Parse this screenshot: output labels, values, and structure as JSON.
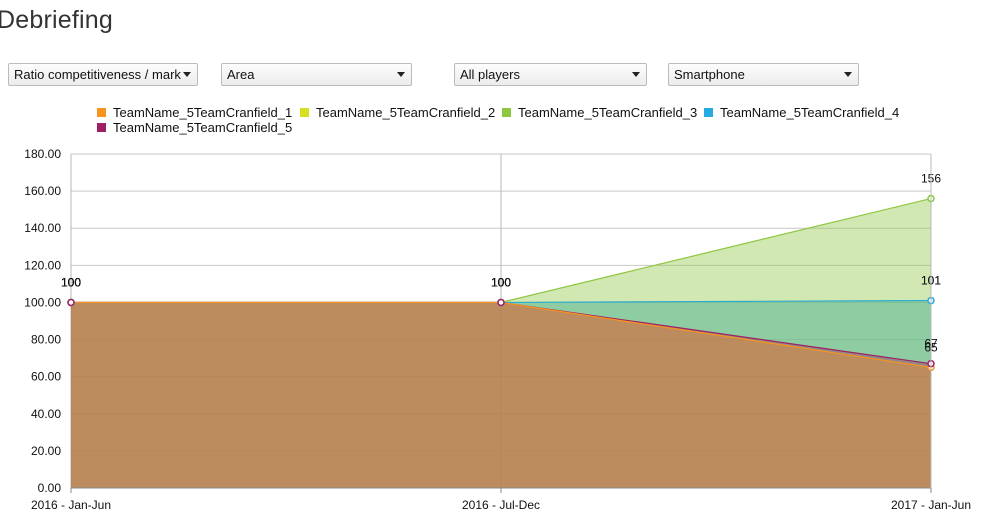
{
  "page": {
    "title": "Debriefing"
  },
  "controls": {
    "metric": {
      "value": "Ratio competitiveness / mark"
    },
    "chart_type": {
      "value": "Area"
    },
    "players": {
      "value": "All players"
    },
    "device": {
      "value": "Smartphone"
    }
  },
  "chart_data": {
    "type": "area",
    "categories": [
      "2016 - Jan-Jun",
      "2016 - Jul-Dec",
      "2017 - Jan-Jun"
    ],
    "ylim": [
      0,
      180
    ],
    "yticks": [
      0,
      20,
      40,
      60,
      80,
      100,
      120,
      140,
      160,
      180
    ],
    "ytick_labels": [
      "0.00",
      "20.00",
      "40.00",
      "60.00",
      "80.00",
      "100.00",
      "120.00",
      "140.00",
      "160.00",
      "180.00"
    ],
    "grid": true,
    "legend_position": "top",
    "series": [
      {
        "name": "TeamName_5TeamCranfield_1",
        "color": "#f7941d",
        "values": [
          100,
          100,
          65
        ],
        "labels": [
          "100",
          "100",
          "65"
        ]
      },
      {
        "name": "TeamName_5TeamCranfield_2",
        "color": "#d7df23",
        "values": [
          100,
          100,
          101
        ],
        "labels": [
          "100",
          "100",
          "101"
        ]
      },
      {
        "name": "TeamName_5TeamCranfield_3",
        "color": "#8dc63f",
        "values": [
          100,
          100,
          156
        ],
        "labels": [
          "100",
          "100",
          "156"
        ]
      },
      {
        "name": "TeamName_5TeamCranfield_4",
        "color": "#27aae1",
        "values": [
          100,
          100,
          101
        ],
        "labels": [
          "100",
          "100",
          "101"
        ]
      },
      {
        "name": "TeamName_5TeamCranfield_5",
        "color": "#9e1f63",
        "values": [
          100,
          100,
          67
        ],
        "labels": [
          "100",
          "100",
          "67"
        ]
      }
    ]
  }
}
